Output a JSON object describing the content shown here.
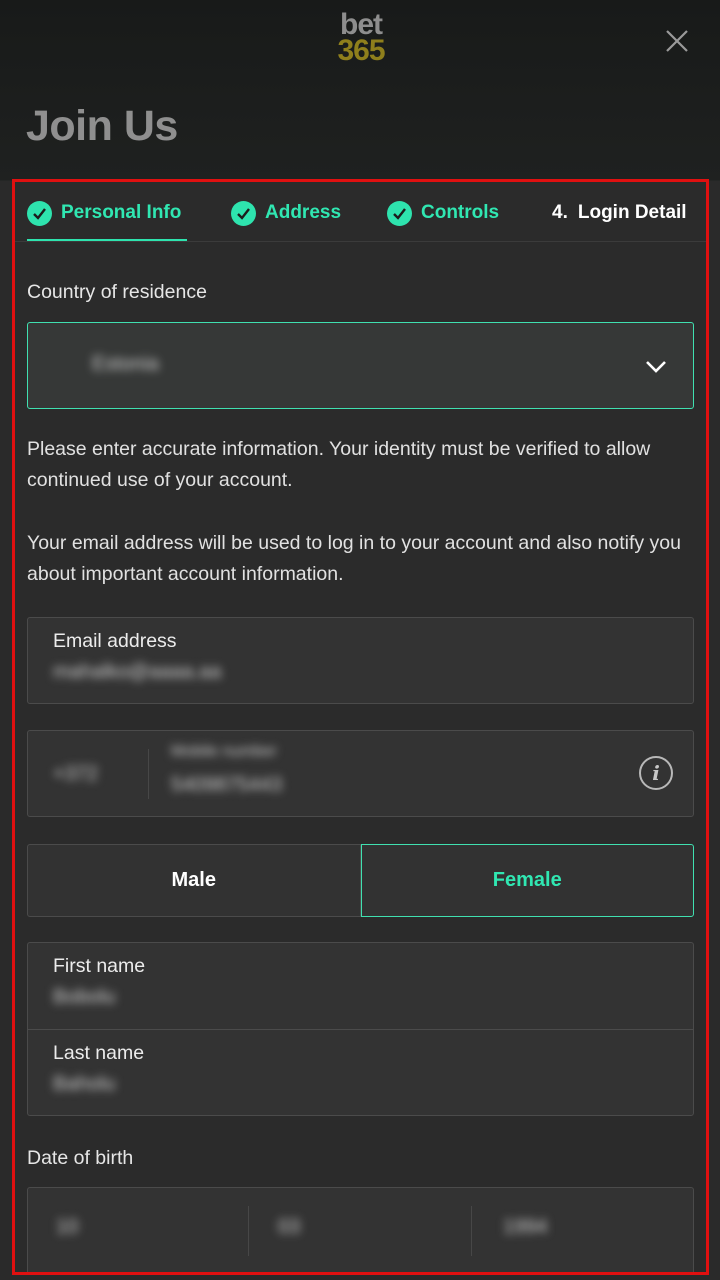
{
  "header": {
    "logo_line1": "bet",
    "logo_line2": "365",
    "title": "Join Us"
  },
  "steps": [
    {
      "label": "Personal Info",
      "done": true
    },
    {
      "label": "Address",
      "done": true
    },
    {
      "label": "Controls",
      "done": true
    },
    {
      "number": "4.",
      "label": "Login Detail",
      "done": false
    }
  ],
  "form": {
    "country_label": "Country of residence",
    "country_value": "Estonia",
    "info_text_1": "Please enter accurate information. Your identity must be verified to allow continued use of your account.",
    "info_text_2": "Your email address will be used to log in to your account and also notify you about important account information.",
    "email_label": "Email address",
    "email_value": "mahalko@aaaa.aa",
    "phone_code": "+372",
    "phone_label": "Mobile number",
    "phone_value": "5409875443",
    "gender_male": "Male",
    "gender_female": "Female",
    "first_name_label": "First name",
    "first_name_value": "Bobolu",
    "last_name_label": "Last name",
    "last_name_value": "Baholu",
    "dob_label": "Date of birth",
    "dob_day": "10",
    "dob_month": "03",
    "dob_year": "1994"
  },
  "colors": {
    "accent": "#2ee3ae",
    "frame": "#e01010"
  }
}
